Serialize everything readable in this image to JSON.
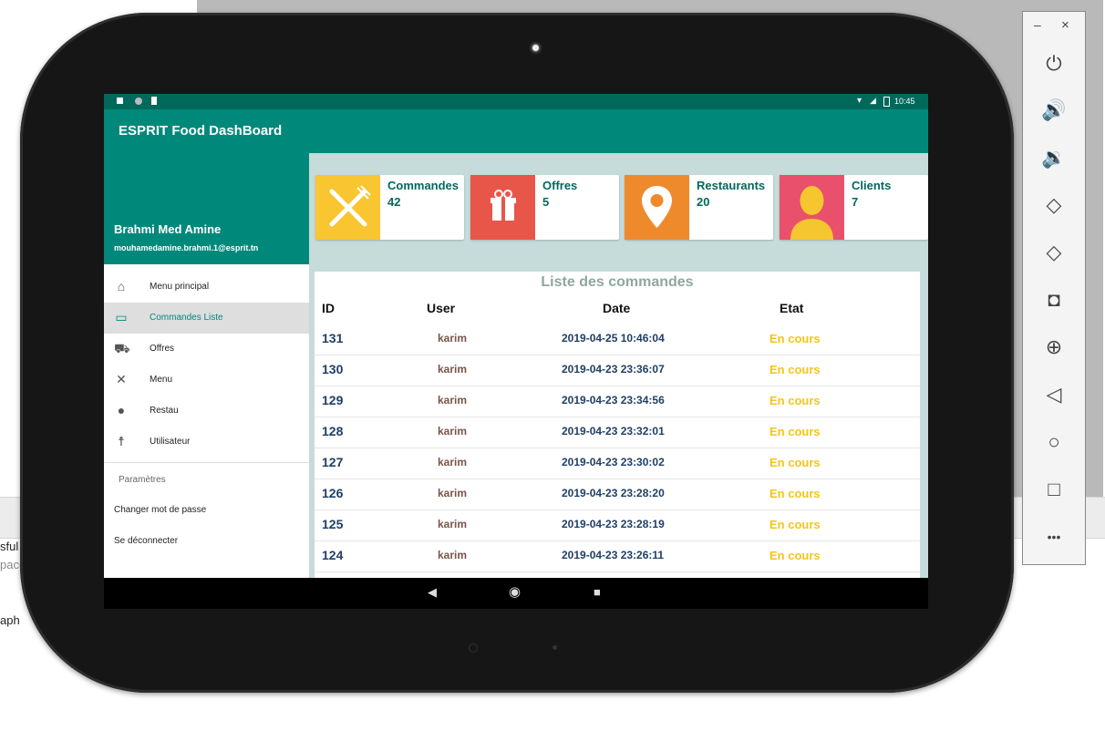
{
  "background": {
    "partial_lines": [
      "sful",
      "pace",
      "aph"
    ]
  },
  "statusbar": {
    "time": "10:45",
    "left_icons": [
      "notification-a-icon",
      "notification-b-icon",
      "sd-card-icon"
    ],
    "right_icons": [
      "wifi-icon",
      "signal-icon",
      "battery-icon"
    ]
  },
  "toolbar": {
    "title": "ESPRIT Food DashBoard"
  },
  "drawer": {
    "user_name": "Brahmi Med Amine",
    "user_email": "mouhamedamine.brahmi.1@esprit.tn",
    "items": [
      {
        "label": "Menu principal",
        "icon": "home-icon",
        "active": false
      },
      {
        "label": "Commandes Liste",
        "icon": "comment-icon",
        "active": true
      },
      {
        "label": "Offres",
        "icon": "cart-icon",
        "active": false
      },
      {
        "label": "Menu",
        "icon": "utensils-icon",
        "active": false
      },
      {
        "label": "Restau",
        "icon": "location-pin-icon",
        "active": false
      },
      {
        "label": "Utilisateur",
        "icon": "person-icon",
        "active": false
      }
    ],
    "section_label": "Paramètres",
    "settings_items": [
      "Changer mot de passe",
      "Se déconnecter"
    ]
  },
  "stats": [
    {
      "title": "Commandes",
      "count": "42",
      "icon": "fork-knife-icon",
      "color": "#f9c530"
    },
    {
      "title": "Offres",
      "count": "5",
      "icon": "gift-icon",
      "color": "#e8564a"
    },
    {
      "title": "Restaurants",
      "count": "20",
      "icon": "map-pin-icon",
      "color": "#ee8a2c"
    },
    {
      "title": "Clients",
      "count": "7",
      "icon": "user-avatar-icon",
      "color": "#e9506b"
    }
  ],
  "orders": {
    "title": "Liste des commandes",
    "headers": [
      "ID",
      "User",
      "Date",
      "Etat"
    ],
    "rows": [
      {
        "id": "131",
        "user": "karim",
        "date": "2019-04-25 10:46:04",
        "etat": "En cours"
      },
      {
        "id": "130",
        "user": "karim",
        "date": "2019-04-23 23:36:07",
        "etat": "En cours"
      },
      {
        "id": "129",
        "user": "karim",
        "date": "2019-04-23 23:34:56",
        "etat": "En cours"
      },
      {
        "id": "128",
        "user": "karim",
        "date": "2019-04-23 23:32:01",
        "etat": "En cours"
      },
      {
        "id": "127",
        "user": "karim",
        "date": "2019-04-23 23:30:02",
        "etat": "En cours"
      },
      {
        "id": "126",
        "user": "karim",
        "date": "2019-04-23 23:28:20",
        "etat": "En cours"
      },
      {
        "id": "125",
        "user": "karim",
        "date": "2019-04-23 23:28:19",
        "etat": "En cours"
      },
      {
        "id": "124",
        "user": "karim",
        "date": "2019-04-23 23:26:11",
        "etat": "En cours"
      }
    ]
  },
  "colors": {
    "primary": "#00897b",
    "primary_dark": "#00695c",
    "status_en_cours": "#f5c518",
    "main_bg": "#c5dcda"
  },
  "emulator_controls": {
    "minimize": "–",
    "close": "×",
    "buttons": [
      "power-icon",
      "volume-up-icon",
      "volume-down-icon",
      "rotate-left-icon",
      "rotate-right-icon",
      "camera-icon",
      "zoom-icon",
      "back-icon",
      "home-icon",
      "overview-icon",
      "more-icon"
    ],
    "more_label": "•••"
  }
}
